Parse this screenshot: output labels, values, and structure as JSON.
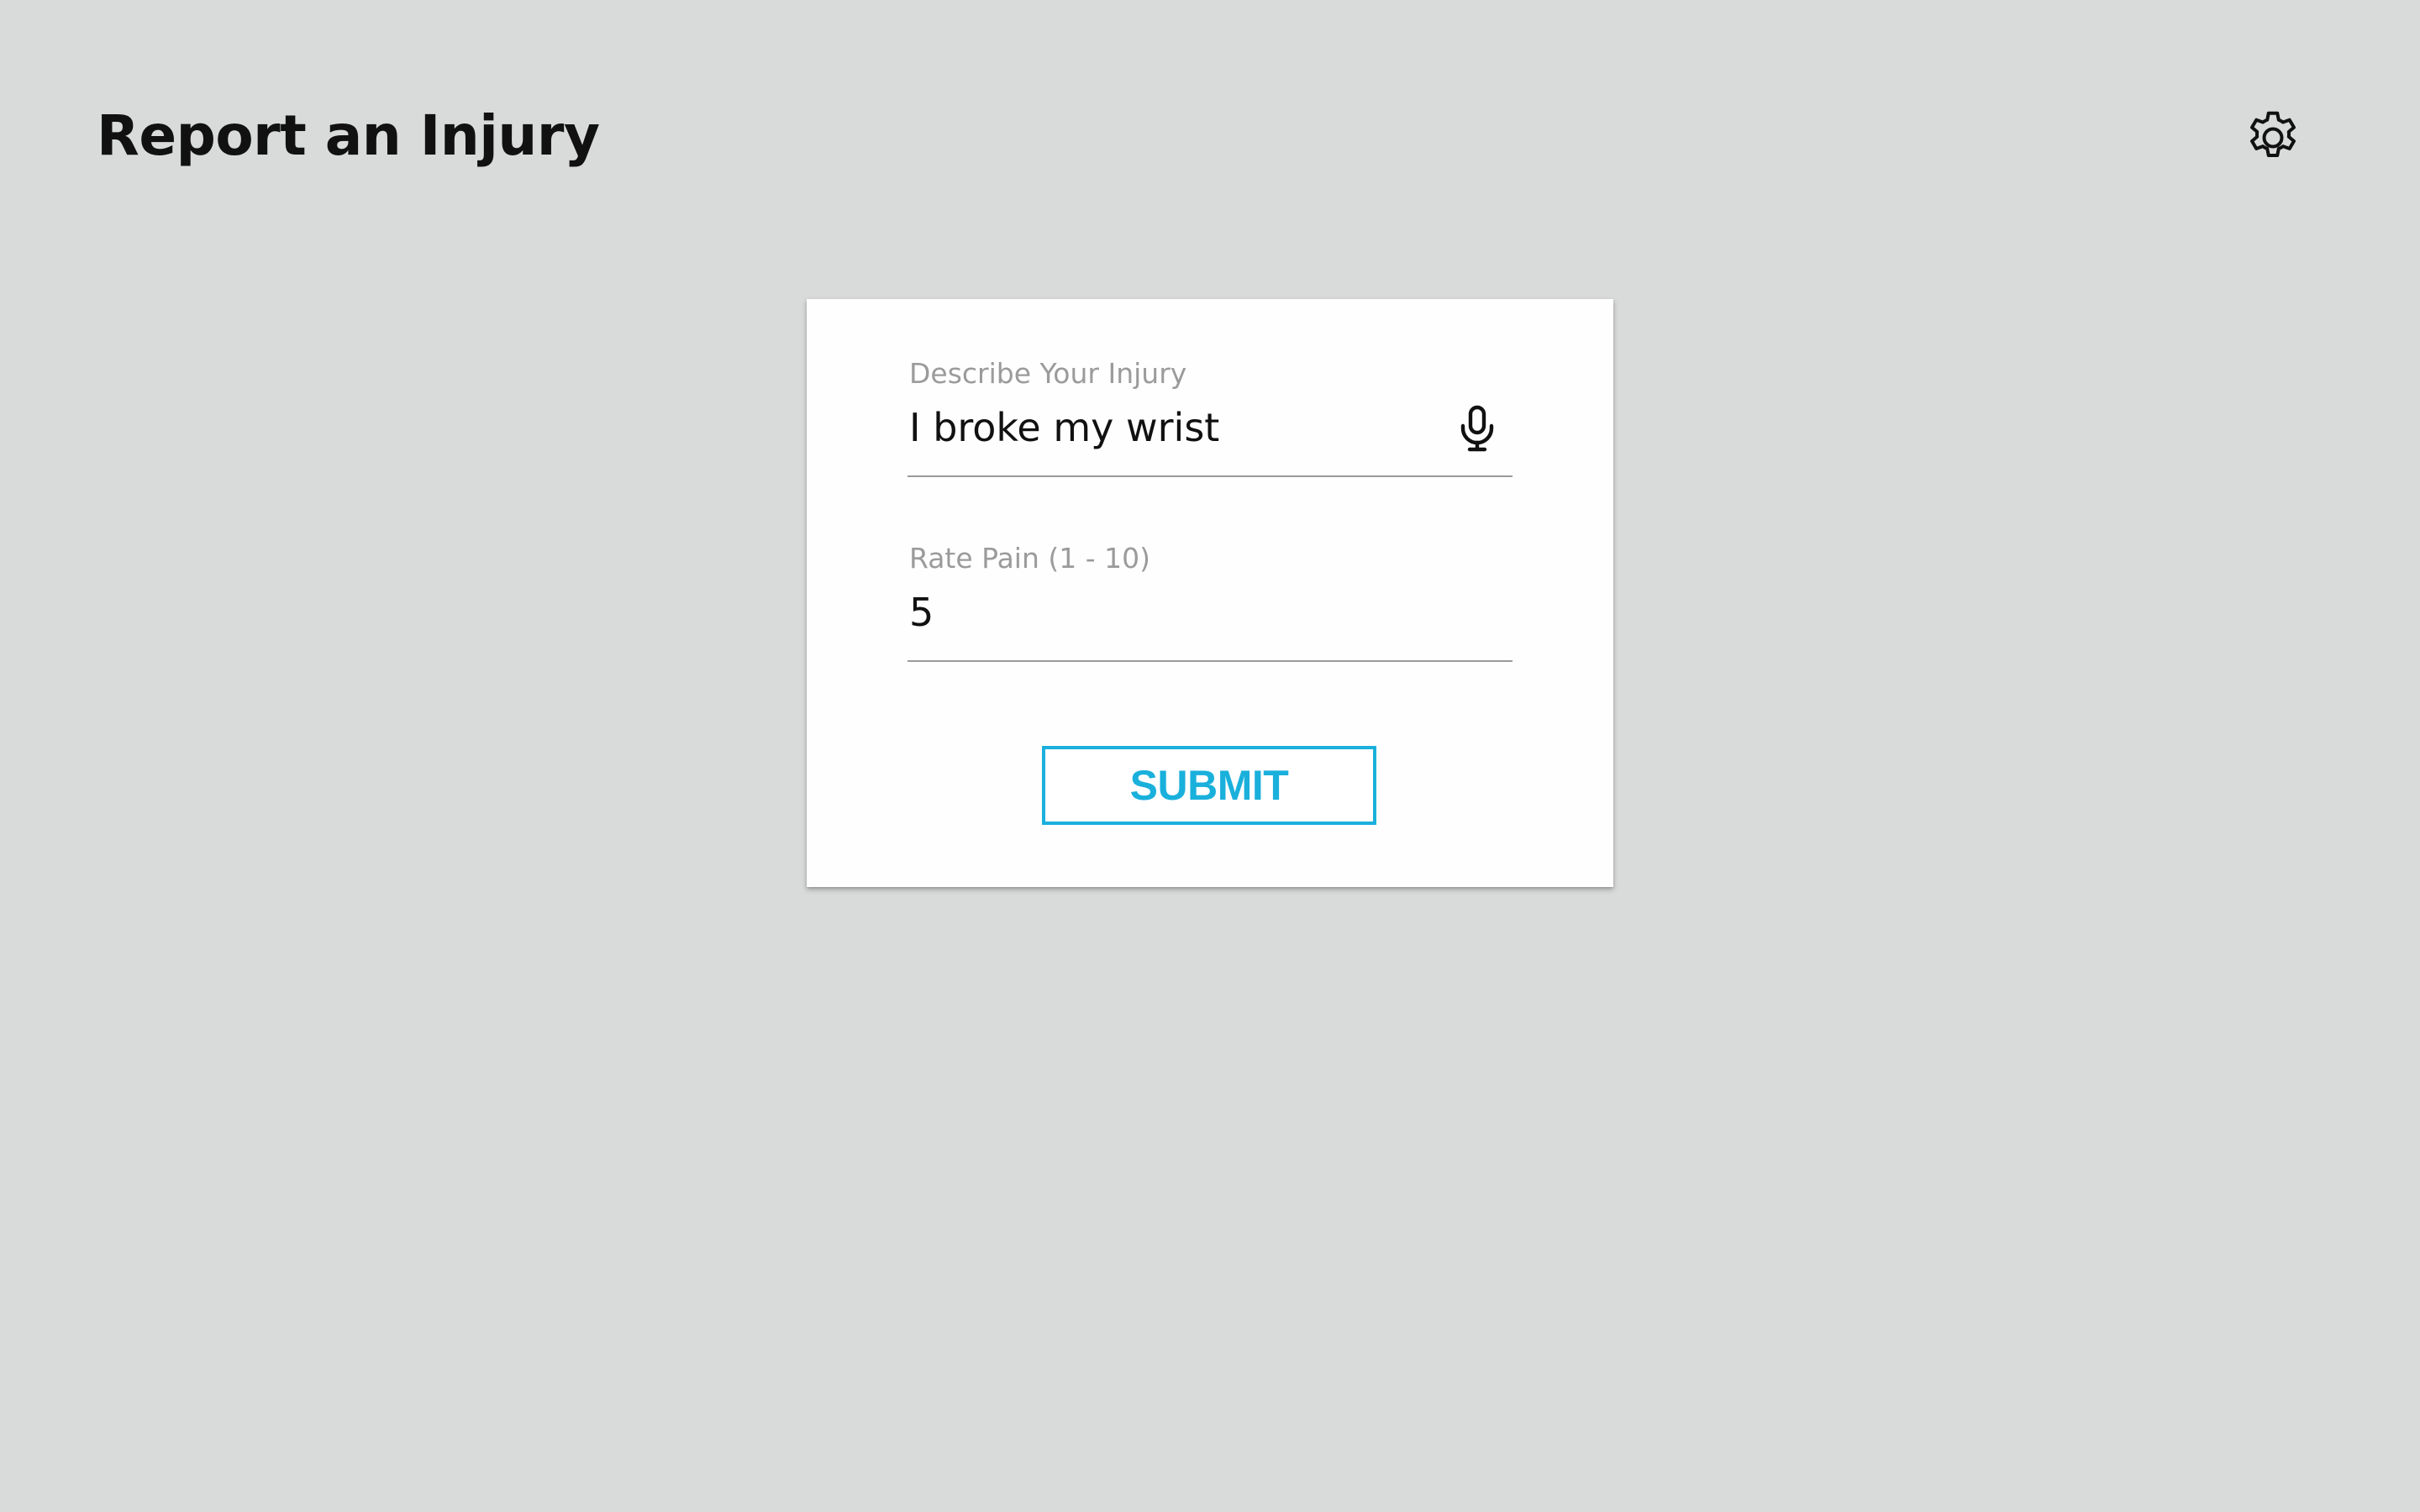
{
  "header": {
    "title": "Report an Injury",
    "settings_icon": "gear-icon"
  },
  "form": {
    "injury_field": {
      "label": "Describe Your Injury",
      "value": "I broke my wrist",
      "icon": "microphone-icon"
    },
    "pain_field": {
      "label": "Rate Pain (1 - 10)",
      "value": "5"
    },
    "submit_label": "SUBMIT"
  },
  "colors": {
    "background": "#d9dbda",
    "card": "#fefefe",
    "accent": "#1ab0dc",
    "label": "#9b9b9b",
    "text": "#111111"
  }
}
